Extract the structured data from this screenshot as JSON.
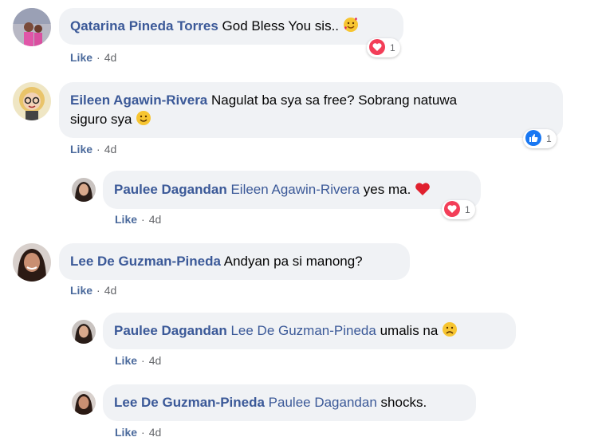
{
  "comments": [
    {
      "author": "Qatarina Pineda Torres",
      "text": "God Bless You sis..",
      "like": "Like",
      "sep": "·",
      "time": "4d",
      "reaction_count": "1",
      "reaction_type": "heart-icon"
    },
    {
      "author": "Eileen Agawin-Rivera",
      "text_line1": "Nagulat ba sya sa free? Sobrang natuwa",
      "text_line2": "siguro sya",
      "like": "Like",
      "sep": "·",
      "time": "4d",
      "reaction_count": "1",
      "reaction_type": "like-thumb-icon"
    },
    {
      "author": "Paulee Dagandan",
      "mention": "Eileen Agawin-Rivera",
      "text": "yes ma.",
      "like": "Like",
      "sep": "·",
      "time": "4d",
      "reaction_count": "1",
      "reaction_type": "heart-icon"
    },
    {
      "author": "Lee De Guzman-Pineda",
      "text": "Andyan pa si manong?",
      "like": "Like",
      "sep": "·",
      "time": "4d"
    },
    {
      "author": "Paulee Dagandan",
      "mention": "Lee De Guzman-Pineda",
      "text": "umalis na",
      "like": "Like",
      "sep": "·",
      "time": "4d"
    },
    {
      "author": "Lee De Guzman-Pineda",
      "mention": "Paulee Dagandan",
      "text": "shocks.",
      "like": "Like",
      "sep": "·",
      "time": "4d"
    }
  ],
  "colors": {
    "author": "#3b5998",
    "bubble": "#f0f2f5",
    "like_blue": "#1877f2",
    "heart_red": "#f33e58"
  }
}
